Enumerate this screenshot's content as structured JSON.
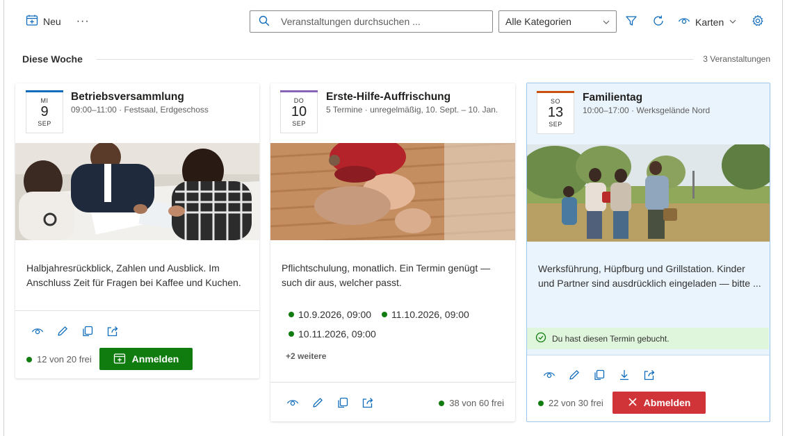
{
  "toolbar": {
    "new_label": "Neu",
    "more_label": "···",
    "search_placeholder": "Veranstaltungen durchsuchen ...",
    "category_selected": "Alle Kategorien",
    "view_label": "Karten"
  },
  "section": {
    "title": "Diese Woche",
    "count": "3 Veranstaltungen"
  },
  "colors": {
    "accent": "#0f6cbd",
    "success": "#107c10",
    "danger": "#d13438",
    "booked_bg": "#eaf4fd",
    "mon_bar": "#0f6cbd",
    "thu_bar": "#8764b8",
    "sun_bar": "#ca5010"
  },
  "events": [
    {
      "dow": "MI",
      "day": "9",
      "month": "SEP",
      "title": "Betriebsversammlung",
      "subtitle": "09:00–11:00 · Festsaal, Erdgeschoss",
      "description": "Halbjahresrückblick, Zahlen und Ausblick. Im Anschluss Zeit für Fragen bei Kaffee und Kuchen.",
      "seats": "12 von 20 frei",
      "action_label": "Anmelden"
    },
    {
      "dow": "DO",
      "day": "10",
      "month": "SEP",
      "title": "Erste-Hilfe-Auffrischung",
      "subtitle": "5 Termine · unregelmäßig, 10. Sept. – 10. Jan.",
      "description": "Pflichtschulung, monatlich. Ein Termin genügt — such dir aus, welcher passt.",
      "sessions": [
        "10.9.2026, 09:00",
        "11.10.2026, 09:00",
        "10.11.2026, 09:00"
      ],
      "more_sessions": "+2 weitere",
      "seats": "38 von 60 frei"
    },
    {
      "dow": "SO",
      "day": "13",
      "month": "SEP",
      "title": "Familientag",
      "subtitle": "10:00–17:00 · Werksgelände Nord",
      "description": "Werksführung, Hüpfburg und Grillstation. Kinder und Partner sind ausdrücklich eingeladen — bitte ...",
      "booked_message": "Du hast diesen Termin gebucht.",
      "seats": "22 von 30 frei",
      "action_label": "Abmelden"
    }
  ]
}
